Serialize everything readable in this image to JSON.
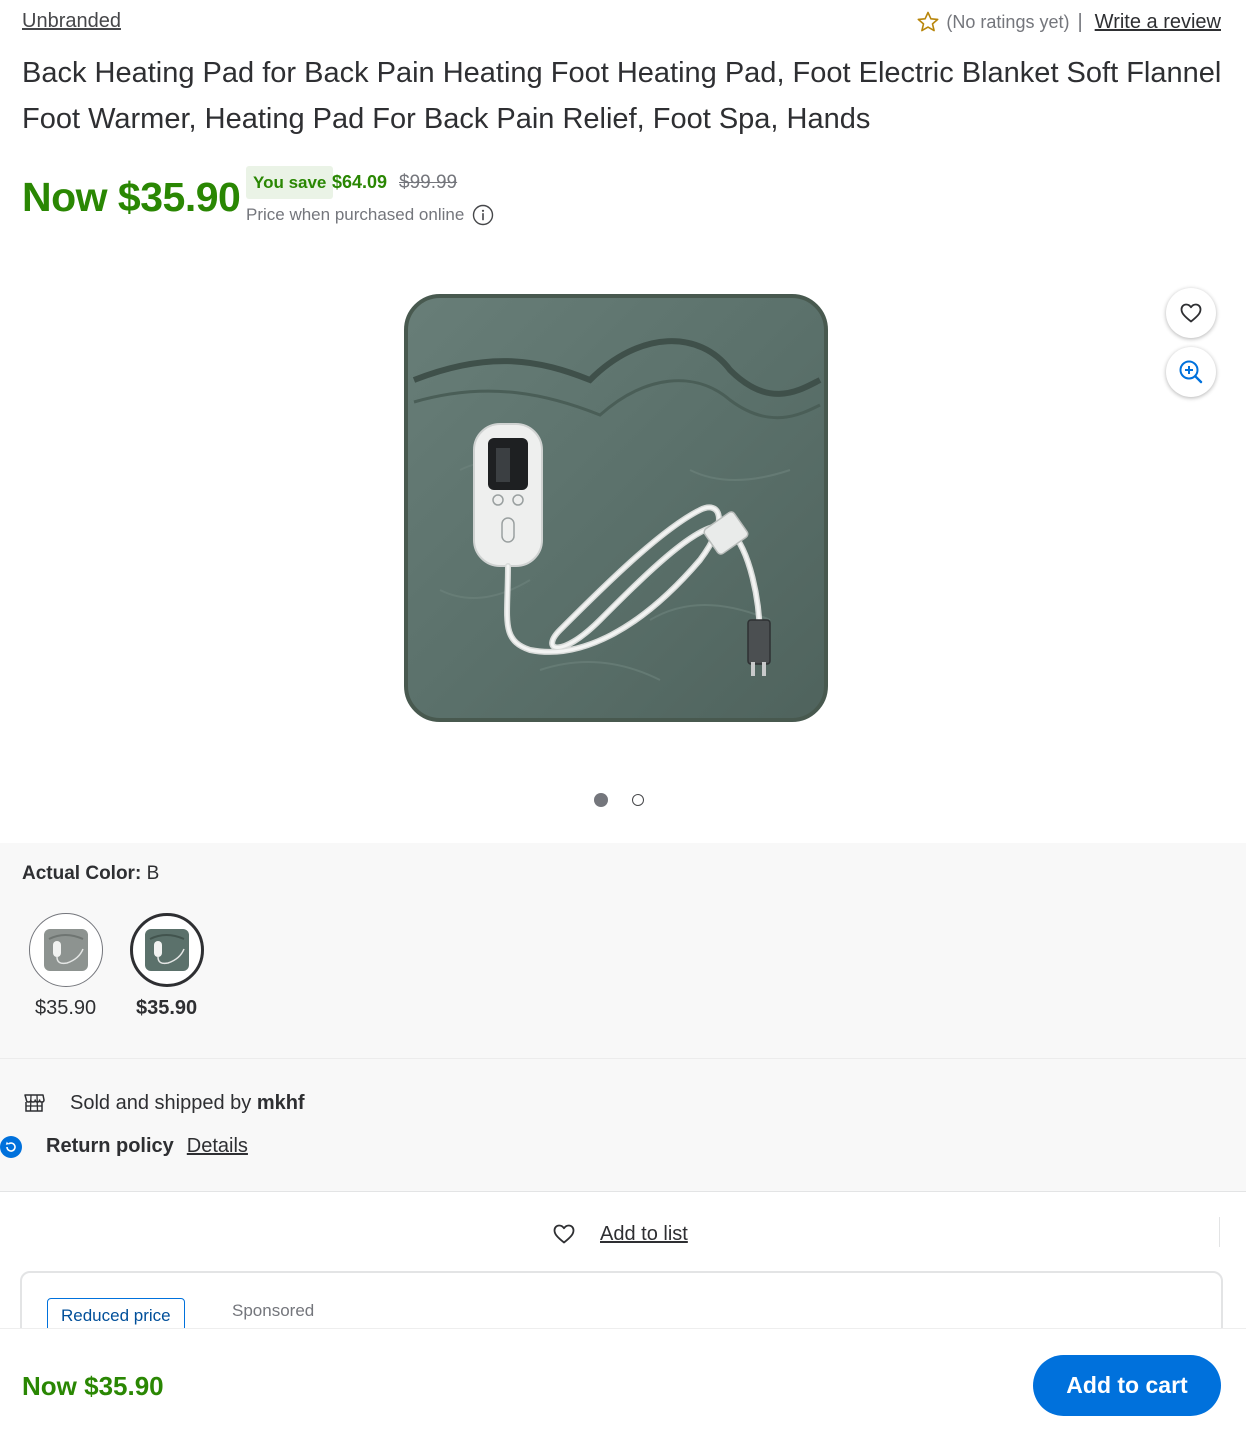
{
  "brand": "Unbranded",
  "rating": {
    "text": "(No ratings yet)",
    "separator": "|",
    "write_review": "Write a review",
    "star_color": "#b8860b"
  },
  "product": {
    "title": "Back Heating Pad for Back Pain Heating Foot Heating Pad, Foot Electric Blanket Soft Flannel Foot Warmer, Heating Pad For Back Pain Relief, Foot Spa, Hands"
  },
  "pricing": {
    "now": "Now $35.90",
    "you_save_label": "You save",
    "save_amount": "$64.09",
    "was_price": "$99.99",
    "note": "Price when purchased online",
    "color": "#2a8703"
  },
  "gallery": {
    "image_icon": "heating-pad-image",
    "favorite_icon": "heart-icon",
    "zoom_icon": "zoom-in-icon",
    "total_images": 2,
    "active_index": 0
  },
  "variants": {
    "label": "Actual Color:",
    "selected": "B",
    "options": [
      {
        "price": "$35.90",
        "selected": false
      },
      {
        "price": "$35.90",
        "selected": true
      }
    ]
  },
  "seller": {
    "prefix": "Sold and shipped by",
    "name": "mkhf",
    "icon": "store-icon"
  },
  "returns": {
    "label": "Return policy",
    "link": "Details",
    "icon": "return-icon"
  },
  "list": {
    "label": "Add to list",
    "icon": "heart-icon"
  },
  "promo_card": {
    "tag": "Reduced price",
    "sponsored": "Sponsored"
  },
  "sticky_bar": {
    "price": "Now $35.90",
    "button": "Add to cart",
    "button_color": "#0071dc"
  }
}
